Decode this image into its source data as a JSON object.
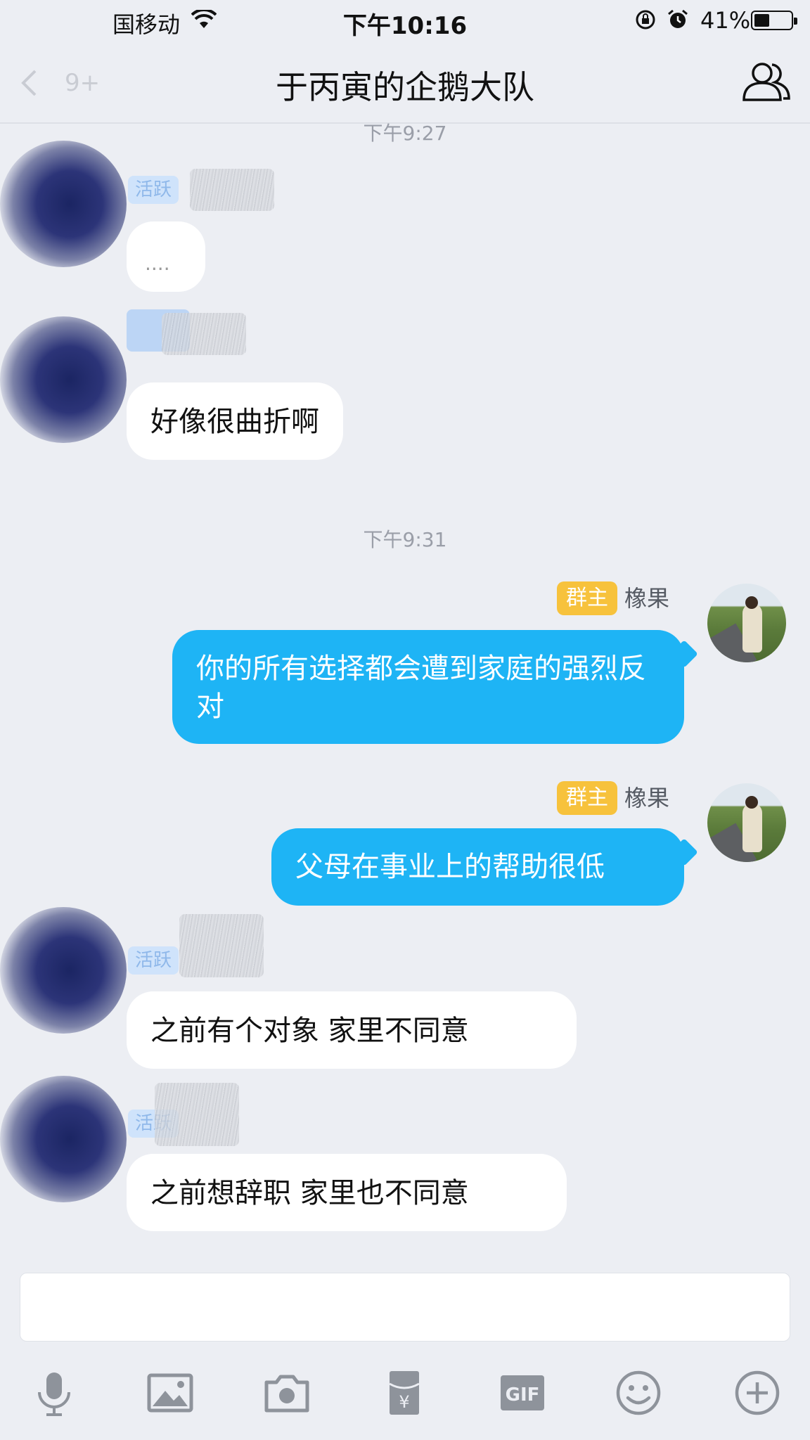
{
  "status_bar": {
    "carrier": "国移动",
    "time": "下午10:16",
    "battery": "41%",
    "battery_level": 0.41
  },
  "nav": {
    "back_badge": "9+",
    "title": "于丙寅的企鹅大队"
  },
  "messages": {
    "timestamp_1": "下午9:27",
    "active_tag": "活跃",
    "typing_dots": "....",
    "msg_1": "好像很曲折啊",
    "timestamp_2": "下午9:31",
    "owner_tag": "群主",
    "owner_name": "橡果",
    "msg_2": "你的所有选择都会遭到家庭的强烈反对",
    "msg_3": "父母在事业上的帮助很低",
    "msg_4": "之前有个对象 家里不同意",
    "msg_5": "之前想辞职 家里也不同意"
  },
  "toolbar": {
    "gif_label": "GIF",
    "items": [
      "microphone-icon",
      "image-icon",
      "camera-icon",
      "red-packet-icon",
      "gif-icon",
      "emoji-icon",
      "plus-icon"
    ]
  },
  "colors": {
    "background": "#eceef3",
    "bubble_self": "#1eb4f5",
    "bubble_other": "#ffffff",
    "owner_tag": "#f7c23c",
    "icon_gray": "#8e939b"
  }
}
